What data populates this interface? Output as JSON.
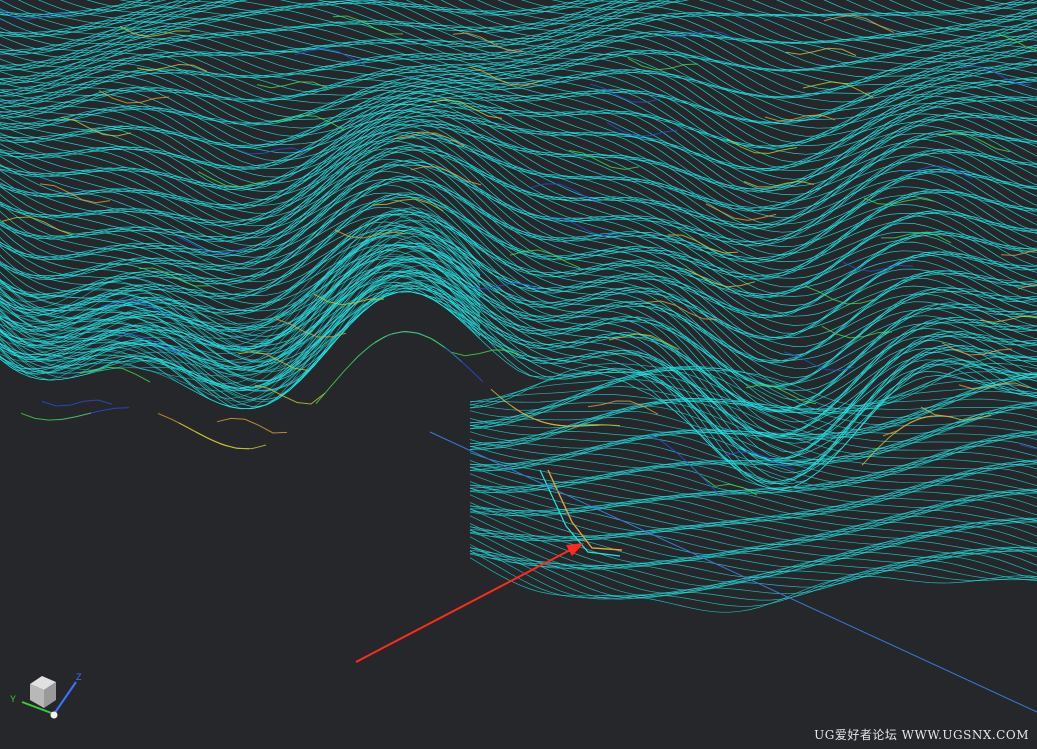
{
  "viewport": {
    "background": "#25272b"
  },
  "toolpath": {
    "primary_color": "#22e6e6",
    "secondary_colors": [
      "#2b4fd8",
      "#c9c938",
      "#48d84a",
      "#e3a23a"
    ],
    "pass_count_upper": 150,
    "pass_count_lower": 70
  },
  "annotation": {
    "arrow_color": "#ff2a1e",
    "icon": "red-arrow-icon"
  },
  "reference_line": {
    "color": "#3a78d4"
  },
  "triad": {
    "icon": "view-triad-icon",
    "x_label": "",
    "y_label": "Y",
    "z_label": "Z",
    "y_color": "#3bcc3b",
    "z_color": "#3a74ff"
  },
  "watermark": {
    "text": "UG爱好者论坛 WWW.UGSNX.COM",
    "color": "#e6e6e6"
  }
}
